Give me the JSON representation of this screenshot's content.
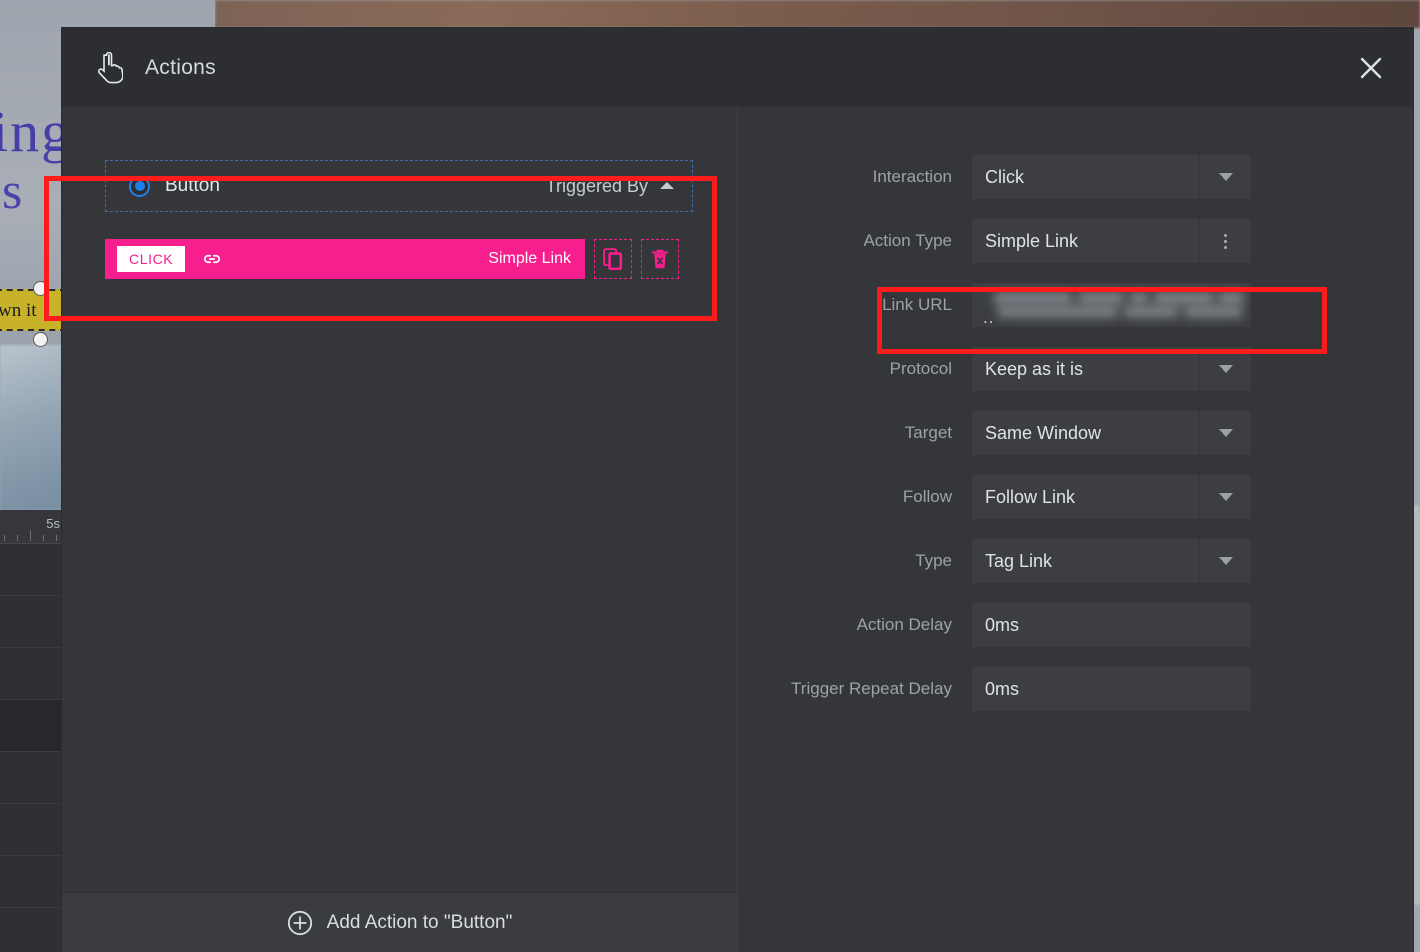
{
  "background": {
    "canvas_text_1": "ing",
    "canvas_text_2": "s  s",
    "selection_band_text": "wn it",
    "timeline_time_label": "5s"
  },
  "modal": {
    "title": "Actions",
    "icon": "tap-hand-icon",
    "close_icon": "close-icon",
    "trigger": {
      "radio_selected": true,
      "label": "Button",
      "triggered_by_label": "Triggered By",
      "collapse_icon": "chevron-up-icon"
    },
    "actions": [
      {
        "event_badge": "CLICK",
        "icon": "link-icon",
        "type_label": "Simple Link",
        "duplicate_icon": "copy-icon",
        "delete_icon": "trash-x-icon",
        "accent_color": "#f71e8e"
      }
    ],
    "footer": {
      "add_icon": "plus-circle-icon",
      "label": "Add Action to \"Button\""
    },
    "properties": [
      {
        "label": "Interaction",
        "value": "Click",
        "control": "select"
      },
      {
        "label": "Action Type",
        "value": "Simple Link",
        "control": "kebab"
      },
      {
        "label": "Link URL",
        "value": "..",
        "control": "blurred-text"
      },
      {
        "label": "Protocol",
        "value": "Keep as it is",
        "control": "select"
      },
      {
        "label": "Target",
        "value": "Same Window",
        "control": "select"
      },
      {
        "label": "Follow",
        "value": "Follow Link",
        "control": "select"
      },
      {
        "label": "Type",
        "value": "Tag Link",
        "control": "select"
      },
      {
        "label": "Action Delay",
        "value": "0ms",
        "control": "text"
      },
      {
        "label": "Trigger Repeat Delay",
        "value": "0ms",
        "control": "text"
      }
    ]
  },
  "annotations": {
    "highlight_color": "#fc1c1c",
    "boxes": [
      "actions-list-highlight",
      "link-url-highlight"
    ]
  }
}
